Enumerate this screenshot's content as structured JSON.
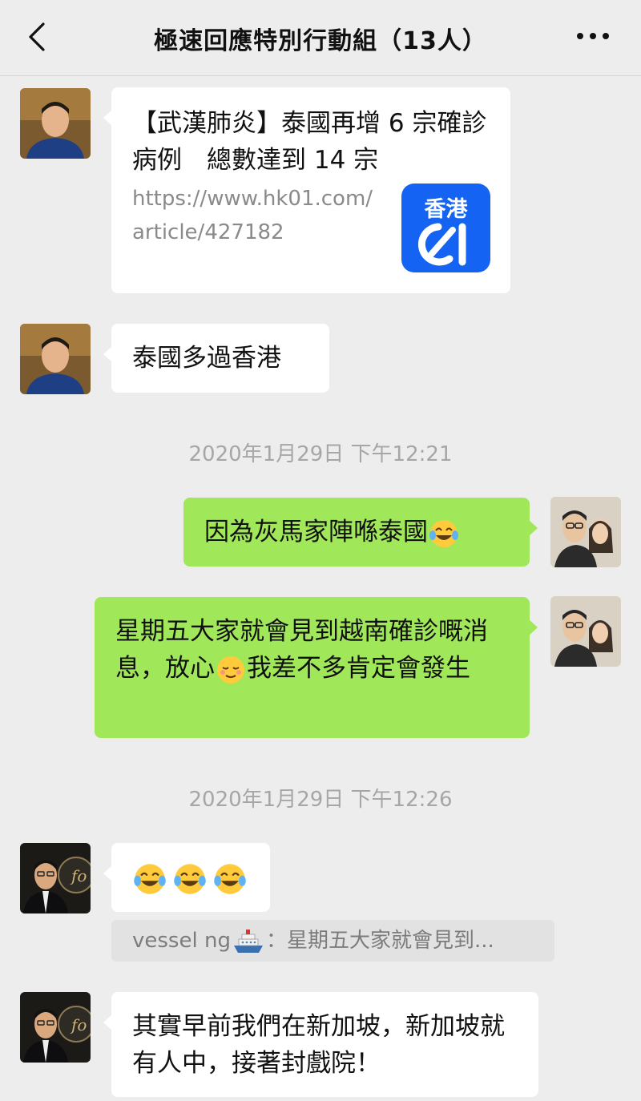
{
  "header": {
    "title": "極速回應特別行動組（13人）"
  },
  "messages": [
    {
      "link_title": "【武漢肺炎】泰國再增 6 宗確診病例　總數達到 14 宗",
      "link_url": "https://www.hk01.com/article/427182",
      "link_logo_text": "香港"
    },
    {
      "text": "泰國多過香港"
    },
    {
      "timestamp": "2020年1月29日 下午12:21"
    },
    {
      "text": "因為灰馬家陣喺泰國"
    },
    {
      "text_before_emoji": "星期五大家就會見到越南確診嘅消息，放心",
      "text_after_emoji": "我差不多肯定會發生"
    },
    {
      "timestamp": "2020年1月29日 下午12:26"
    },
    {
      "emoji_message": "😂😂😂"
    },
    {
      "quote_name": "vessel ng",
      "quote_text": "：星期五大家就會見到..."
    },
    {
      "text": "其實早前我們在新加坡，新加坡就有人中，接著封戲院！"
    }
  ],
  "colors": {
    "sent_bubble": "#a0e75a",
    "received_bubble": "#ffffff",
    "background": "#ededed",
    "hk01_brand": "#1463f3"
  },
  "icons": [
    "back-icon",
    "more-icon",
    "cruise-ship-emoji",
    "tears-of-joy-emoji",
    "relieved-emoji"
  ]
}
